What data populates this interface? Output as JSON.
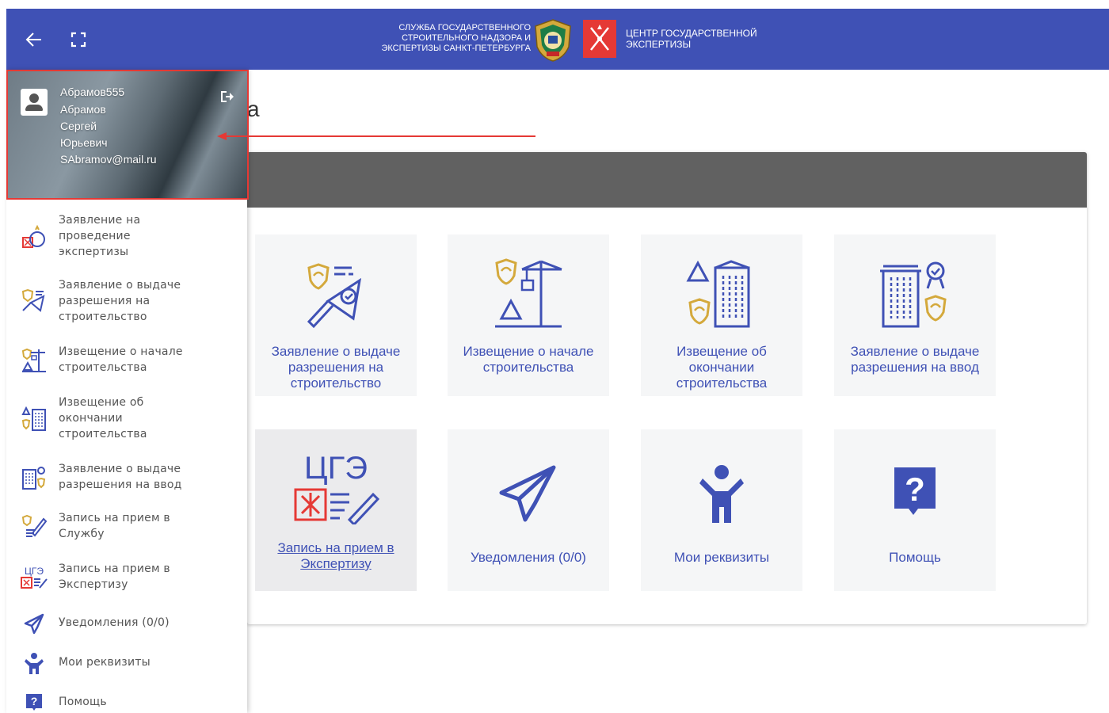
{
  "header": {
    "org1_lines": [
      "СЛУЖБА ГОСУДАРСТВЕННОГО",
      "СТРОИТЕЛЬНОГО НАДЗОРА И",
      "ЭКСПЕРТИЗЫ САНКТ-ПЕТЕРБУРГА"
    ],
    "org2_lines": [
      "ЦЕНТР ГОСУДАРСТВЕННОЙ",
      "ЭКСПЕРТИЗЫ"
    ],
    "brand_color": "#3f51b5"
  },
  "page": {
    "title_fragment": "а"
  },
  "profile": {
    "login": "Абрамов555",
    "last_name": "Абрамов",
    "first_name": "Сергей",
    "middle_name": "Юрьевич",
    "email": "SAbramov@mail.ru"
  },
  "sidebar": {
    "items": [
      {
        "label": "Заявление на\nпроведение\nэкспертизы",
        "icon": "expertise-application-icon"
      },
      {
        "label": "Заявление о выдаче\nразрешения на\nстроительство",
        "icon": "building-permit-icon"
      },
      {
        "label": "Извещение о начале\nстроительства",
        "icon": "construction-start-icon"
      },
      {
        "label": "Извещение об\nокончании\nстроительства",
        "icon": "construction-end-icon"
      },
      {
        "label": "Заявление о выдаче\nразрешения на ввод",
        "icon": "commissioning-permit-icon"
      },
      {
        "label": "Запись на прием в\nСлужбу",
        "icon": "service-appointment-icon"
      },
      {
        "label": "Запись на прием в\nЭкспертизу",
        "icon": "expertise-appointment-icon"
      },
      {
        "label": "Уведомления (0/0)",
        "icon": "paper-plane-icon"
      },
      {
        "label": "Мои реквизиты",
        "icon": "person-icon"
      },
      {
        "label": "Помощь",
        "icon": "help-icon"
      }
    ]
  },
  "tiles": [
    {
      "label": "Заявление о выдаче\nразрешения на\nстроительство",
      "icon": "building-permit-icon"
    },
    {
      "label": "Извещение о начале\nстроительства",
      "icon": "construction-start-icon"
    },
    {
      "label": "Извещение об\nокончании\nстроительства",
      "icon": "construction-end-icon"
    },
    {
      "label": "Заявление о выдаче\nразрешения на ввод",
      "icon": "commissioning-permit-icon"
    },
    {
      "label": "Запись на прием в\nЭкспертизу",
      "icon": "expertise-appointment-icon",
      "logo_text": "ЦГЭ"
    },
    {
      "label": "Уведомления (0/0)",
      "icon": "paper-plane-icon"
    },
    {
      "label": "Мои реквизиты",
      "icon": "person-icon"
    },
    {
      "label": "Помощь",
      "icon": "help-icon"
    }
  ],
  "colors": {
    "gold": "#d4a93c",
    "blue": "#3f51b5",
    "red": "#e53935"
  }
}
